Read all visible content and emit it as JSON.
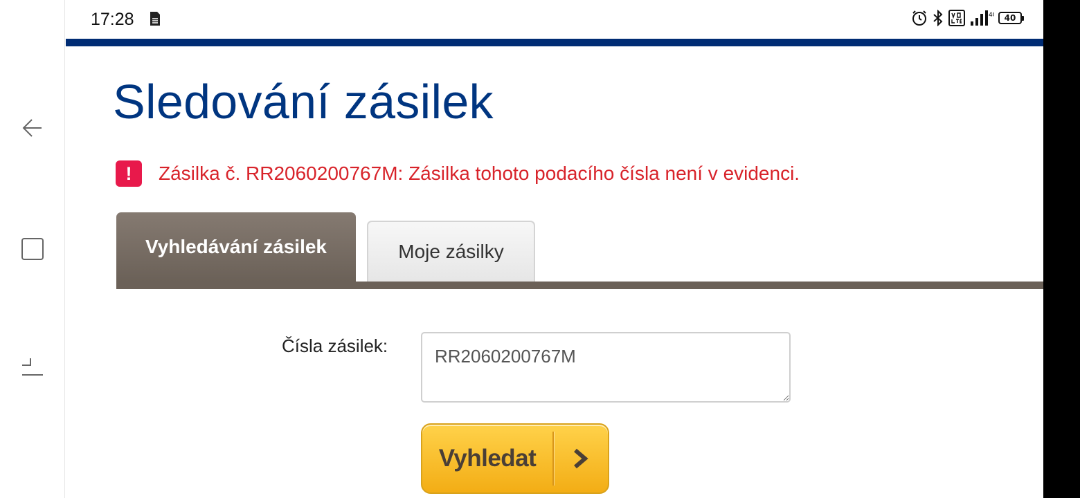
{
  "status_bar": {
    "time": "17:28",
    "battery": "40",
    "icons": [
      "sim-card-icon",
      "alarm-icon",
      "bluetooth-icon",
      "volte-icon",
      "signal-icon",
      "4g-icon",
      "battery-icon"
    ]
  },
  "nav": {
    "back_icon": "back-arrow-icon",
    "home_icon": "home-square-icon",
    "recents_icon": "recents-icon"
  },
  "page": {
    "title": "Sledování zásilek",
    "error_icon_glyph": "!",
    "error_message": "Zásilka č. RR2060200767M: Zásilka tohoto podacího čísla není v evidenci."
  },
  "tabs": [
    {
      "label": "Vyhledávání zásilek",
      "active": true
    },
    {
      "label": "Moje zásilky",
      "active": false
    }
  ],
  "form": {
    "label": "Čísla zásilek:",
    "value": "RR2060200767M",
    "button_label": "Vyhledat"
  },
  "colors": {
    "brand_blue": "#002c74",
    "title_blue": "#003580",
    "error_red": "#d8232a",
    "error_icon_bg": "#e8194b",
    "tab_active_bg": "#6b6158",
    "button_yellow": "#f3ad15"
  }
}
